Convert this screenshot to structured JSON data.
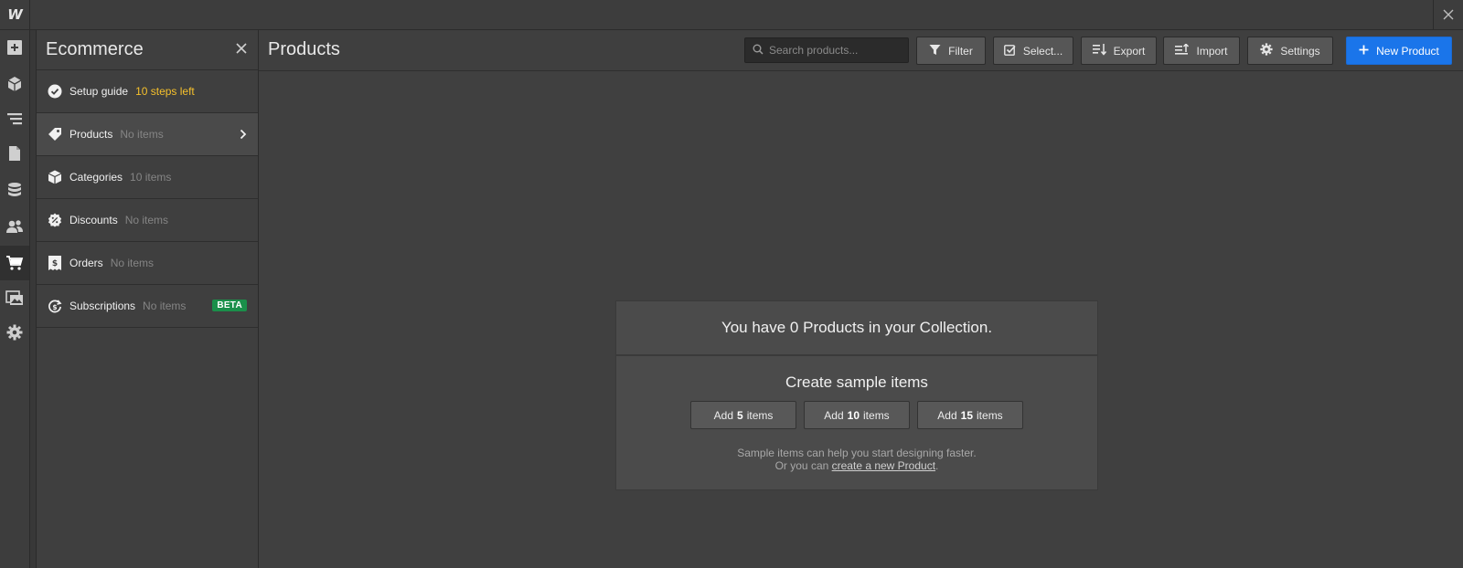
{
  "app": {
    "logo": "W"
  },
  "sidebar": {
    "title": "Ecommerce",
    "items": [
      {
        "label": "Setup guide",
        "count": "10 steps left",
        "icon": "check-circle-icon"
      },
      {
        "label": "Products",
        "count": "No items",
        "icon": "tag-icon"
      },
      {
        "label": "Categories",
        "count": "10 items",
        "icon": "box-icon"
      },
      {
        "label": "Discounts",
        "count": "No items",
        "icon": "discount-icon"
      },
      {
        "label": "Orders",
        "count": "No items",
        "icon": "receipt-icon"
      },
      {
        "label": "Subscriptions",
        "count": "No items",
        "icon": "subscription-icon",
        "badge": "BETA"
      }
    ]
  },
  "main": {
    "title": "Products",
    "search": {
      "placeholder": "Search products..."
    },
    "toolbar": {
      "filter": "Filter",
      "select": "Select...",
      "export": "Export",
      "import": "Import",
      "settings": "Settings",
      "new_product": "New Product"
    },
    "empty": {
      "headline": "You have 0 Products in your Collection.",
      "subtitle": "Create sample items",
      "add_prefix": "Add",
      "add_suffix": "items",
      "add_counts": [
        "5",
        "10",
        "15"
      ],
      "hint_line1": "Sample items can help you start designing faster.",
      "hint_line2_prefix": "Or you can",
      "hint_link": "create a new Product",
      "hint_line2_suffix": "."
    }
  },
  "colors": {
    "accent": "#1a75ea",
    "warning": "#f5c02c",
    "beta": "#1a8f4a",
    "background": "#404040"
  }
}
